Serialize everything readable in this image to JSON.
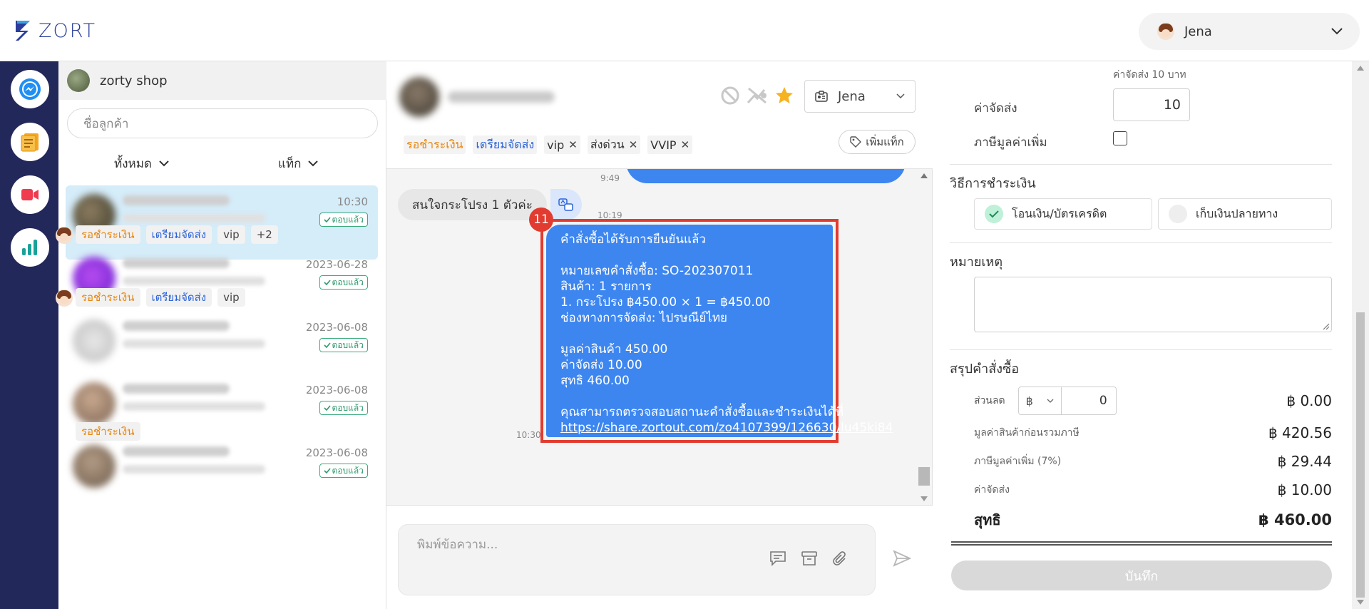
{
  "header": {
    "logo_text": "ZORT",
    "user_name": "Jena"
  },
  "rail": {
    "items": [
      "messenger-icon",
      "orders-icon",
      "video-icon",
      "analytics-icon"
    ]
  },
  "contacts": {
    "shop_name": "zorty shop",
    "search_placeholder": "ชื่อลูกค้า",
    "filter_all": "ทั้งหมด",
    "filter_tag": "แท็ก",
    "replied_label": "ตอบแล้ว",
    "items": [
      {
        "time": "10:30",
        "tags": [
          "รอชำระเงิน",
          "เตรียมจัดส่ง",
          "vip",
          "+2"
        ]
      },
      {
        "time": "2023-06-28",
        "tags": [
          "รอชำระเงิน",
          "เตรียมจัดส่ง",
          "vip"
        ]
      },
      {
        "time": "2023-06-08",
        "tags": []
      },
      {
        "time": "2023-06-08",
        "tags": [
          "รอชำระเงิน"
        ]
      },
      {
        "time": "2023-06-08",
        "tags": []
      }
    ]
  },
  "chat": {
    "agent": "Jena",
    "tags": [
      "รอชำระเงิน",
      "เตรียมจัดส่ง",
      "vip",
      "ส่งด่วน",
      "VVIP"
    ],
    "add_tag": "เพิ่มแท็ก",
    "messages": {
      "time_top": "9:49",
      "incoming": "สนใจกระโปรง 1 ตัวค่ะ",
      "time_incoming": "10:19",
      "badge": "11",
      "order_title": "คำสั่งซื้อได้รับการยืนยันแล้ว",
      "order_no_label": "หมายเลขคำสั่งซื้อ:",
      "order_no": " SO-202307011",
      "items_label": "สินค้า:",
      "items_value": " 1 รายการ",
      "item_line": "1. กระโปรง ฿450.00 × 1 = ฿450.00",
      "shipping_label": "ช่องทางการจัดส่ง:",
      "shipping_value": " ไปรษณีย์ไทย",
      "goods_label": "มูลค่าสินค้า",
      "goods_value": " 450.00",
      "ship_fee_label": "ค่าจัดส่ง",
      "ship_fee_value": " 10.00",
      "net_label": "สุทธิ",
      "net_value": " 460.00",
      "check_text": "คุณสามารถตรวจสอบสถานะคำสั่งซื้อและชำระเงินได้ที่",
      "link": "https://share.zortout.com/zo4107399/126630/lu45ki84",
      "time_order": "10:30"
    },
    "composer_placeholder": "พิมพ์ข้อความ..."
  },
  "order_panel": {
    "shipping_hint": "ค่าจัดส่ง 10 บาท",
    "shipping_label": "ค่าจัดส่ง",
    "shipping_value": "10",
    "vat_label": "ภาษีมูลค่าเพิ่ม",
    "payment_title": "วิธีการชำระเงิน",
    "payment_options": [
      "โอนเงิน/บัตรเครดิต",
      "เก็บเงินปลายทาง"
    ],
    "note_title": "หมายเหตุ",
    "summary_title": "สรุปคำสั่งซื้อ",
    "discount_label": "ส่วนลด",
    "discount_currency": "฿",
    "discount_value": "0",
    "discount_total": "฿ 0.00",
    "pre_tax_label": "มูลค่าสินค้าก่อนรวมภาษี",
    "pre_tax_value": "฿ 420.56",
    "vat_rate_label": "ภาษีมูลค่าเพิ่ม (7%)",
    "vat_value": "฿ 29.44",
    "ship_label": "ค่าจัดส่ง",
    "ship_value": "฿ 10.00",
    "net_label": "สุทธิ",
    "net_value": "฿ 460.00",
    "save_label": "บันทึก"
  },
  "colors": {
    "rail_bg": "#23285a",
    "bubble_blue": "#3d86f0",
    "highlight_red": "#e23b2f",
    "tag_orange": "#e8860e",
    "tag_blue": "#2b63d9",
    "replied_green": "#2e9a6d"
  }
}
